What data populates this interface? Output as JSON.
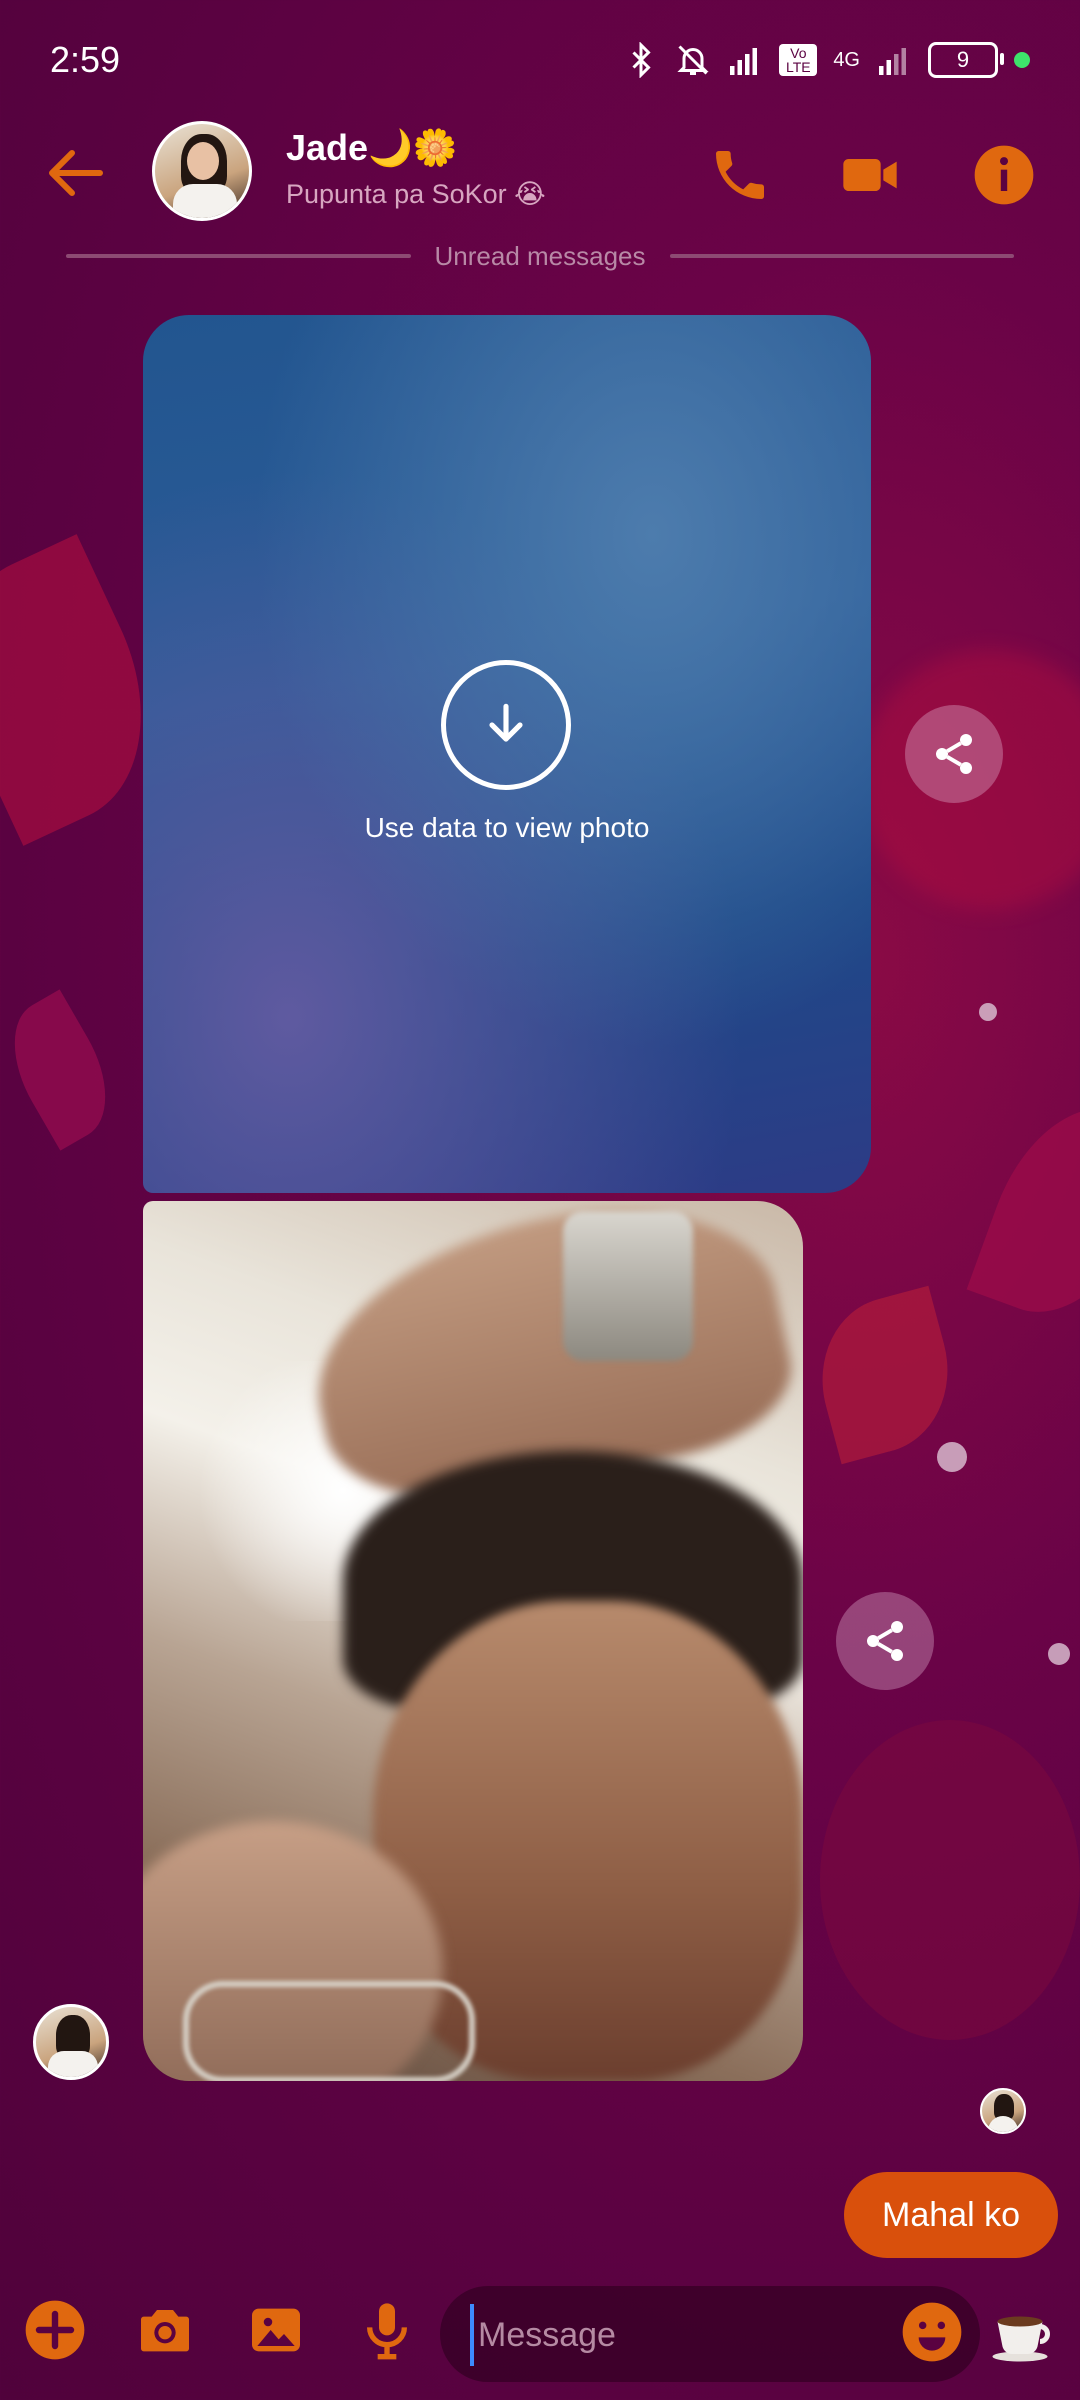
{
  "status_bar": {
    "time": "2:59",
    "network": "4G",
    "volte": "Vo LTE",
    "battery": "9"
  },
  "header": {
    "contact_name": "Jade🌙🌼",
    "status_text": "Pupunta pa SoKor 😭"
  },
  "divider": {
    "label": "Unread messages"
  },
  "messages": {
    "photo1_prompt": "Use data to view photo",
    "sent_text": "Mahal ko"
  },
  "composer": {
    "placeholder": "Message"
  },
  "colors": {
    "accent": "#e0680f",
    "background": "#5a0241",
    "sent_bubble": "#d9500c"
  },
  "icons": [
    "back-arrow-icon",
    "phone-icon",
    "video-camera-icon",
    "info-icon",
    "share-icon",
    "download-icon",
    "plus-icon",
    "camera-icon",
    "gallery-icon",
    "microphone-icon",
    "emoji-icon",
    "coffee-cup-icon"
  ]
}
